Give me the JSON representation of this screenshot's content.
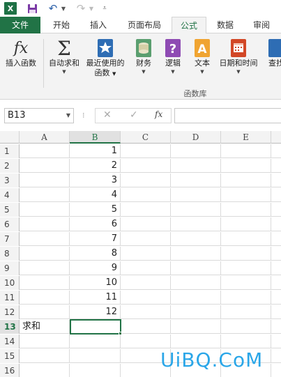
{
  "qat": {
    "app_logo": "X",
    "icons": [
      "excel-logo-icon",
      "save-icon",
      "undo-icon",
      "redo-icon",
      "customize-icon"
    ]
  },
  "tabs": [
    "文件",
    "开始",
    "插入",
    "页面布局",
    "公式",
    "数据",
    "审阅"
  ],
  "active_tab": "公式",
  "ribbon": {
    "buttons": [
      {
        "label": "插入函数",
        "label2": "",
        "icon": "fx-icon"
      },
      {
        "label": "自动求和",
        "label2": "",
        "icon": "sigma-icon"
      },
      {
        "label": "最近使用的",
        "label2": "函数",
        "icon": "star-book-icon"
      },
      {
        "label": "财务",
        "label2": "",
        "icon": "coins-icon"
      },
      {
        "label": "逻辑",
        "label2": "",
        "icon": "question-book-icon"
      },
      {
        "label": "文本",
        "label2": "",
        "icon": "text-book-icon"
      },
      {
        "label": "日期和时间",
        "label2": "",
        "icon": "calendar-book-icon"
      },
      {
        "label": "查找",
        "label2": "",
        "icon": "lookup-book-icon"
      }
    ],
    "group_label": "函数库"
  },
  "formula_bar": {
    "name_box": "B13",
    "fx_label": "fx",
    "formula": ""
  },
  "columns": [
    "A",
    "B",
    "C",
    "D",
    "E"
  ],
  "rows": [
    {
      "n": "1",
      "A": "",
      "B": "1"
    },
    {
      "n": "2",
      "A": "",
      "B": "2"
    },
    {
      "n": "3",
      "A": "",
      "B": "3"
    },
    {
      "n": "4",
      "A": "",
      "B": "4"
    },
    {
      "n": "5",
      "A": "",
      "B": "5"
    },
    {
      "n": "6",
      "A": "",
      "B": "6"
    },
    {
      "n": "7",
      "A": "",
      "B": "7"
    },
    {
      "n": "8",
      "A": "",
      "B": "8"
    },
    {
      "n": "9",
      "A": "",
      "B": "9"
    },
    {
      "n": "10",
      "A": "",
      "B": "10"
    },
    {
      "n": "11",
      "A": "",
      "B": "11"
    },
    {
      "n": "12",
      "A": "",
      "B": "12"
    },
    {
      "n": "13",
      "A": "求和",
      "B": ""
    },
    {
      "n": "14",
      "A": "",
      "B": ""
    },
    {
      "n": "15",
      "A": "",
      "B": ""
    },
    {
      "n": "16",
      "A": "",
      "B": ""
    }
  ],
  "active_cell": "B13",
  "watermark": "UiBQ.CoM",
  "colors": {
    "accent": "#217346",
    "watermark": "#2aa6e8"
  }
}
